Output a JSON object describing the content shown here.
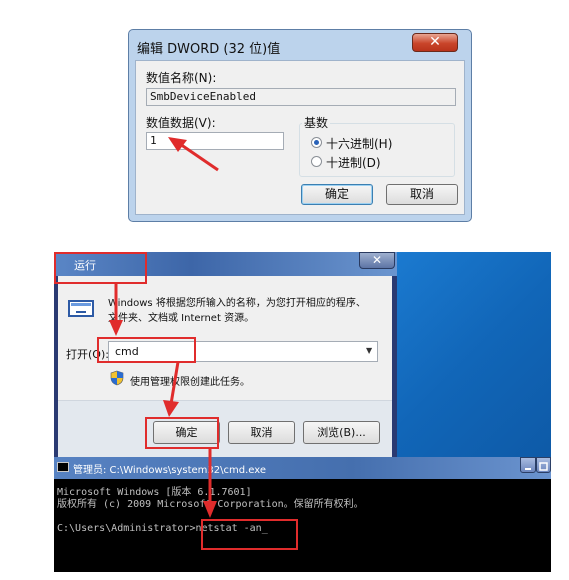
{
  "dword_dialog": {
    "title": "编辑 DWORD (32 位)值",
    "close_glyph": "✕",
    "value_name_label": "数值名称(N):",
    "value_name": "SmbDeviceEnabled",
    "value_data_label": "数值数据(V):",
    "value_data": "1",
    "base_label": "基数",
    "base_options": [
      {
        "label": "十六进制(H)",
        "selected": true
      },
      {
        "label": "十进制(D)",
        "selected": false
      }
    ],
    "ok_label": "确定",
    "cancel_label": "取消"
  },
  "run_dialog": {
    "title": "运行",
    "close_glyph": "✕",
    "description_line1": "Windows 将根据您所输入的名称，为您打开相应的程序、",
    "description_line2": "文件夹、文档或 Internet 资源。",
    "open_label": "打开(O):",
    "open_value": "cmd",
    "admin_note": "使用管理权限创建此任务。",
    "ok_label": "确定",
    "cancel_label": "取消",
    "browse_label": "浏览(B)..."
  },
  "cmd_window": {
    "title": "管理员: C:\\Windows\\system32\\cmd.exe",
    "lines": [
      "Microsoft Windows [版本 6.1.7601]",
      "版权所有 (c) 2009 Microsoft Corporation。保留所有权利。",
      "",
      "C:\\Users\\Administrator>netstat -an_"
    ]
  },
  "colors": {
    "annotation_red": "#e02c2c",
    "dialog_frame": "#bcd3ec",
    "run_title_bar": "#3d66a8",
    "cmd_background": "#000000"
  },
  "icons": [
    "close-icon",
    "run-program-icon",
    "uac-shield-icon",
    "console-icon",
    "dropdown-arrow-icon"
  ]
}
